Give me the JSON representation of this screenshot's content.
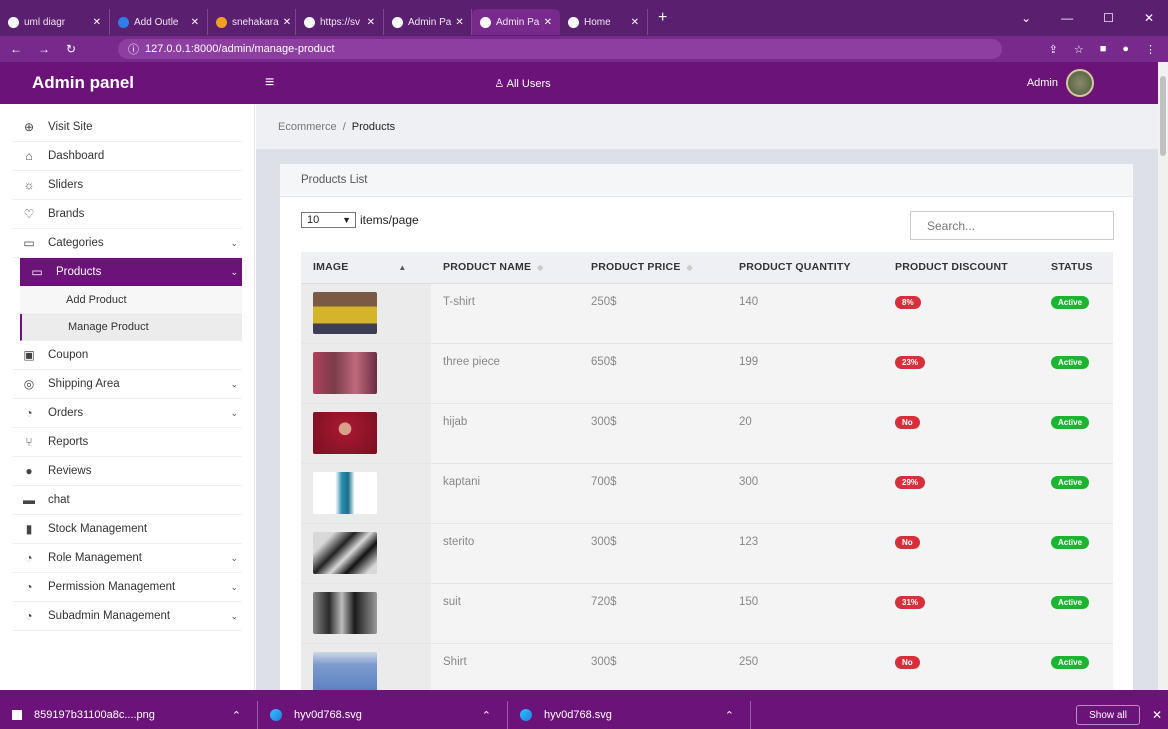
{
  "browser": {
    "tabs": [
      {
        "label": "uml diagr",
        "active": false
      },
      {
        "label": "Add Outle",
        "active": false
      },
      {
        "label": "snehakara",
        "active": false
      },
      {
        "label": "https://sv",
        "active": false
      },
      {
        "label": "Admin Pa",
        "active": false
      },
      {
        "label": "Admin Pa",
        "active": true
      },
      {
        "label": "Home",
        "active": false
      }
    ],
    "new_tab": "+",
    "url": "127.0.0.1:8000/admin/manage-product"
  },
  "header": {
    "brand": "Admin panel",
    "all_users": "All Users",
    "admin_label": "Admin"
  },
  "sidebar": {
    "items": [
      {
        "label": "Visit Site",
        "icon": "globe-icon",
        "glyph": "⊕"
      },
      {
        "label": "Dashboard",
        "icon": "home-icon",
        "glyph": "⌂"
      },
      {
        "label": "Sliders",
        "icon": "sun-icon",
        "glyph": "☼"
      },
      {
        "label": "Brands",
        "icon": "heart-icon",
        "glyph": "♡"
      },
      {
        "label": "Categories",
        "icon": "folder-icon",
        "glyph": "▭"
      },
      {
        "label": "Products",
        "icon": "folder-open-icon",
        "glyph": "▭"
      },
      {
        "label": "Coupon",
        "icon": "calendar-icon",
        "glyph": "▣"
      },
      {
        "label": "Shipping Area",
        "icon": "location-icon",
        "glyph": "◎"
      },
      {
        "label": "Orders",
        "icon": "clock-icon",
        "glyph": "◔"
      },
      {
        "label": "Reports",
        "icon": "branch-icon",
        "glyph": "⑂"
      },
      {
        "label": "Reviews",
        "icon": "info-icon",
        "glyph": "●"
      },
      {
        "label": "chat",
        "icon": "chat-icon",
        "glyph": "▬"
      },
      {
        "label": "Stock Management",
        "icon": "bookmark-icon",
        "glyph": "▮"
      },
      {
        "label": "Role Management",
        "icon": "clock-icon",
        "glyph": "◔"
      },
      {
        "label": "Permission Management",
        "icon": "clock-icon",
        "glyph": "◔"
      },
      {
        "label": "Subadmin Management",
        "icon": "clock-icon",
        "glyph": "◔"
      }
    ],
    "submenu": [
      "Add Product",
      "Manage Product"
    ]
  },
  "breadcrumb": {
    "parent": "Ecommerce",
    "sep": "/",
    "current": "Products"
  },
  "card": {
    "title": "Products List",
    "page_size": "10",
    "page_size_suffix": "items/page",
    "search_placeholder": "Search..."
  },
  "table": {
    "columns": [
      "IMAGE",
      "PRODUCT NAME",
      "PRODUCT PRICE",
      "PRODUCT QUANTITY",
      "PRODUCT DISCOUNT",
      "STATUS"
    ],
    "rows": [
      {
        "name": "T-shirt",
        "price": "250$",
        "qty": "140",
        "discount": "8%",
        "status": "Active"
      },
      {
        "name": "three piece",
        "price": "650$",
        "qty": "199",
        "discount": "23%",
        "status": "Active"
      },
      {
        "name": "hijab",
        "price": "300$",
        "qty": "20",
        "discount": "No",
        "status": "Active"
      },
      {
        "name": "kaptani",
        "price": "700$",
        "qty": "300",
        "discount": "29%",
        "status": "Active"
      },
      {
        "name": "sterito",
        "price": "300$",
        "qty": "123",
        "discount": "No",
        "status": "Active"
      },
      {
        "name": "suit",
        "price": "720$",
        "qty": "150",
        "discount": "31%",
        "status": "Active"
      },
      {
        "name": "Shirt",
        "price": "300$",
        "qty": "250",
        "discount": "No",
        "status": "Active"
      }
    ]
  },
  "downloads": {
    "files": [
      "859197b31100a8c....png",
      "hyv0d768.svg",
      "hyv0d768.svg"
    ],
    "show_all": "Show all"
  },
  "colors": {
    "brand": "#6c1379",
    "danger": "#d72f3b",
    "success": "#1cb531"
  }
}
